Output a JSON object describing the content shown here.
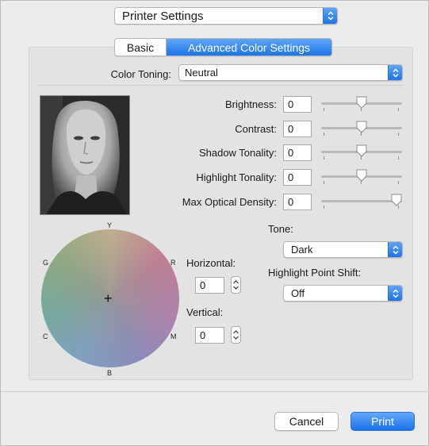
{
  "printer_settings_popup": {
    "value": "Printer Settings"
  },
  "tabs": [
    {
      "label": "Basic",
      "selected": false
    },
    {
      "label": "Advanced Color Settings",
      "selected": true
    }
  ],
  "color_toning": {
    "label": "Color Toning:",
    "value": "Neutral"
  },
  "adjustments": {
    "brightness": {
      "label": "Brightness:",
      "value": "0",
      "level": 0.5
    },
    "contrast": {
      "label": "Contrast:",
      "value": "0",
      "level": 0.5
    },
    "shadow_tonality": {
      "label": "Shadow Tonality:",
      "value": "0",
      "level": 0.5
    },
    "highlight_tonality": {
      "label": "Highlight Tonality:",
      "value": "0",
      "level": 0.5
    },
    "max_optical_density": {
      "label": "Max Optical Density:",
      "value": "0",
      "level": 1.0
    }
  },
  "color_wheel": {
    "labels": {
      "top": "Y",
      "left_top": "G",
      "right_top": "R",
      "left_bottom": "C",
      "right_bottom": "M",
      "bottom": "B"
    }
  },
  "horizontal": {
    "label": "Horizontal:",
    "value": "0"
  },
  "vertical": {
    "label": "Vertical:",
    "value": "0"
  },
  "tone": {
    "label": "Tone:",
    "value": "Dark"
  },
  "highlight_point_shift": {
    "label": "Highlight Point Shift:",
    "value": "Off"
  },
  "buttons": {
    "cancel": "Cancel",
    "print": "Print"
  },
  "colors": {
    "accent": "#1d74e9",
    "panel": "#e3e3e3",
    "window": "#ececec"
  }
}
